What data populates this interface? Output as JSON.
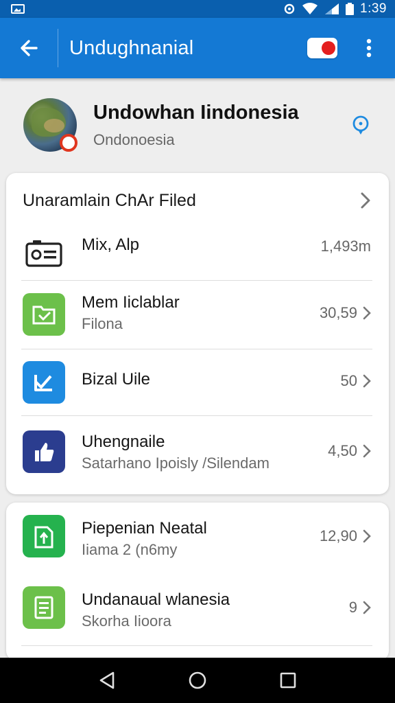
{
  "status_bar": {
    "time": "1:39"
  },
  "app_bar": {
    "title": "Undughnanial"
  },
  "profile": {
    "name": "Undowhan Iindonesia",
    "subtitle": "Ondonoesia"
  },
  "card1": {
    "header": "Unaramlain ChAr Filed",
    "rows": [
      {
        "title": "Mix, Alp",
        "subtitle": "",
        "value": "1,493m",
        "icon": "id-card-icon",
        "icon_bg": "#ffffff"
      },
      {
        "title": "Mem Iiclablar",
        "subtitle": "Filona",
        "value": "30,59",
        "icon": "folder-icon",
        "icon_bg": "#6cc04a"
      },
      {
        "title": "Bizal Uile",
        "subtitle": "",
        "value": "50",
        "icon": "check-icon",
        "icon_bg": "#1e8be0"
      },
      {
        "title": "Uhengnaile",
        "subtitle": "Satarhano Ipoisly /Silendam",
        "value": "4,50",
        "icon": "thumbs-up-icon",
        "icon_bg": "#2b3d8f"
      }
    ]
  },
  "card2": {
    "rows": [
      {
        "title": "Piepenian Neatal",
        "subtitle": "Iiama 2 (n6my",
        "value": "12,90",
        "icon": "upload-icon",
        "icon_bg": "#25b24e"
      },
      {
        "title": "Undanaual wlanesia",
        "subtitle": "Skorha Iioora",
        "value": "9",
        "icon": "document-icon",
        "icon_bg": "#6cc04a"
      }
    ]
  },
  "colors": {
    "status_bar": "#0a5fae",
    "app_bar": "#1479d4",
    "accent": "#1e8be0"
  }
}
